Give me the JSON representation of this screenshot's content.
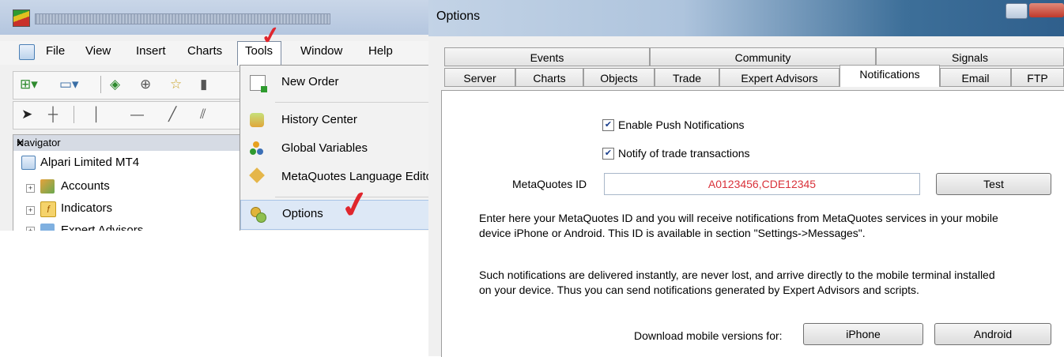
{
  "mt4": {
    "menu": [
      "File",
      "View",
      "Insert",
      "Charts",
      "Tools",
      "Window",
      "Help"
    ],
    "navigator": {
      "title": "Navigator",
      "close": "×",
      "root": "Alpari Limited MT4",
      "items": [
        "Accounts",
        "Indicators",
        "Expert Advisors"
      ]
    },
    "tools_menu": [
      {
        "label": "New Order",
        "icon": "new-order-icon"
      },
      {
        "label": "History Center",
        "icon": "history-center-icon"
      },
      {
        "label": "Global Variables",
        "icon": "global-variables-icon"
      },
      {
        "label": "MetaQuotes Language Editor",
        "icon": "metaeditor-icon"
      },
      {
        "label": "Options",
        "icon": "options-icon"
      }
    ]
  },
  "options": {
    "title": "Options",
    "tabs_back": [
      "Events",
      "Community",
      "Signals"
    ],
    "tabs_front": [
      "Server",
      "Charts",
      "Objects",
      "Trade",
      "Expert Advisors",
      "Notifications",
      "Email",
      "FTP"
    ],
    "active_tab": "Notifications",
    "enable_push": {
      "label": "Enable Push Notifications",
      "checked": true
    },
    "notify_trade": {
      "label": "Notify of trade transactions",
      "checked": true
    },
    "id_label": "MetaQuotes ID",
    "id_value": "A0123456,CDE12345",
    "test_button": "Test",
    "para1_line1": "Enter here your MetaQuotes ID and you will receive notifications from MetaQuotes services in your mobile",
    "para1_line2": "device iPhone or Android. This ID is available in section \"Settings->Messages\".",
    "para2_line1": "Such notifications are delivered instantly, are never lost, and arrive directly to the mobile terminal installed",
    "para2_line2": "on your device. Thus you can send notifications generated by Expert Advisors and scripts.",
    "download_label": "Download mobile versions for:",
    "iphone_button": "iPhone",
    "android_button": "Android"
  },
  "colors": {
    "id_text": "#d9323a",
    "annotation_check": "#e0262d",
    "menu_highlight": "#dde8f6"
  }
}
